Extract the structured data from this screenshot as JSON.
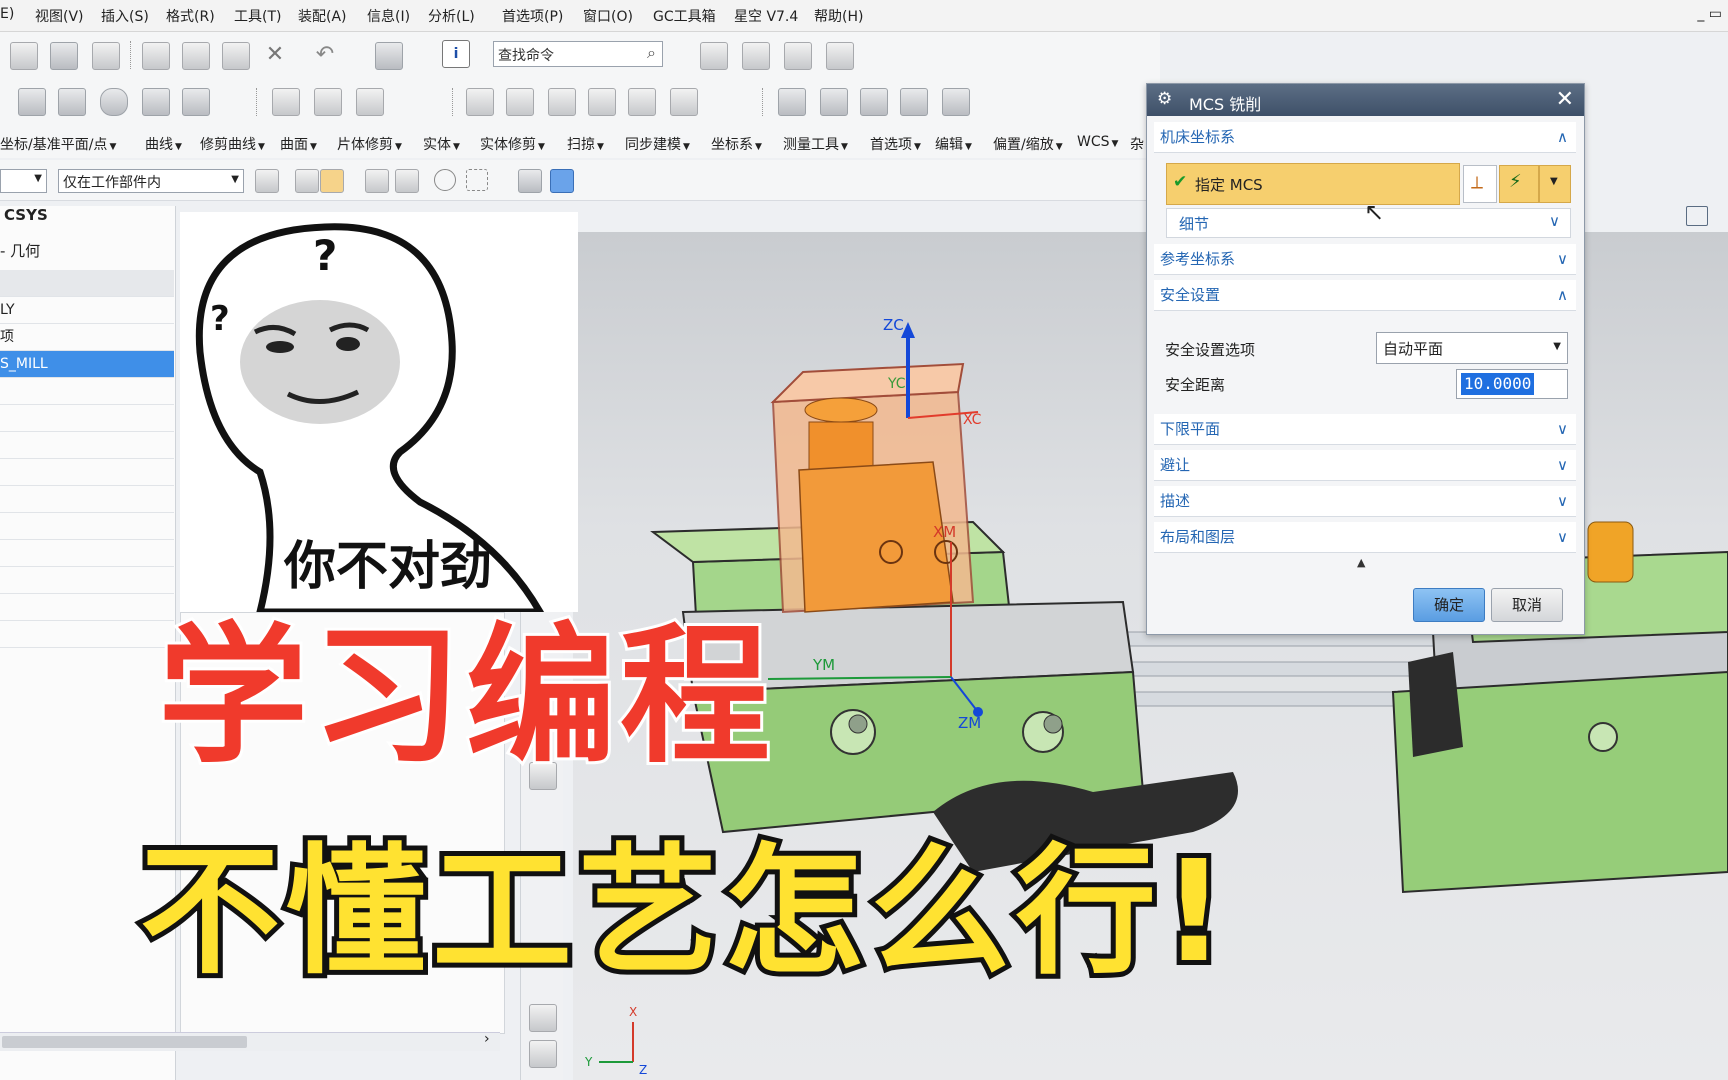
{
  "menu": {
    "items": [
      "E)",
      "视图(V)",
      "插入(S)",
      "格式(R)",
      "工具(T)",
      "装配(A)",
      "信息(I)",
      "分析(L)",
      "首选项(P)",
      "窗口(O)",
      "GC工具箱",
      "星空 V7.4",
      "帮助(H)"
    ],
    "window_controls": "_ ▭"
  },
  "toolbar": {
    "search_placeholder": "查找命令",
    "filter_value": "仅在工作部件内",
    "commands": [
      "坐标/基准平面/点",
      "曲线",
      "修剪曲线",
      "曲面",
      "片体修剪",
      "实体",
      "实体修剪",
      "扫掠",
      "同步建模",
      "坐标系",
      "测量工具",
      "首选项",
      "编辑",
      "偏置/缩放",
      "WCS",
      "杂"
    ]
  },
  "navigator": {
    "header": "CSYS",
    "subheader": "- 几何",
    "rows": [
      "LY",
      "项",
      "S_MILL"
    ],
    "selected_row": "S_MILL"
  },
  "viewport": {
    "axis_labels": {
      "zc": "ZC",
      "yc": "YC",
      "xc": "XC",
      "xm": "XM",
      "ym": "YM",
      "zm": "ZM",
      "triad_x": "X",
      "triad_y": "Y",
      "triad_z": "Z"
    }
  },
  "dialog": {
    "title": "MCS 铣削",
    "sections": {
      "machine_csys": "机床坐标系",
      "specify_mcs": "指定 MCS",
      "details": "细节",
      "ref_csys": "参考坐标系",
      "clearance": "安全设置",
      "clearance_option_label": "安全设置选项",
      "clearance_option_value": "自动平面",
      "safe_distance_label": "安全距离",
      "safe_distance_value": "10.0000",
      "lower_plane": "下限平面",
      "avoidance": "避让",
      "description": "描述",
      "layout_layers": "布局和图层"
    },
    "ok_label": "确定",
    "cancel_label": "取消"
  },
  "overlay": {
    "meme_caption": "你不对劲",
    "line1": "学习编程",
    "line2": "不懂工艺怎么行!"
  },
  "colors": {
    "dialog_title_bg": "#4a5c74",
    "highlight": "#f6cf6e",
    "selection_blue": "#3f8fe8",
    "headline_red": "#f03a2c",
    "headline_yellow": "#ffe231",
    "part_orange": "#f29a3a",
    "vise_green": "#9fd27c"
  }
}
